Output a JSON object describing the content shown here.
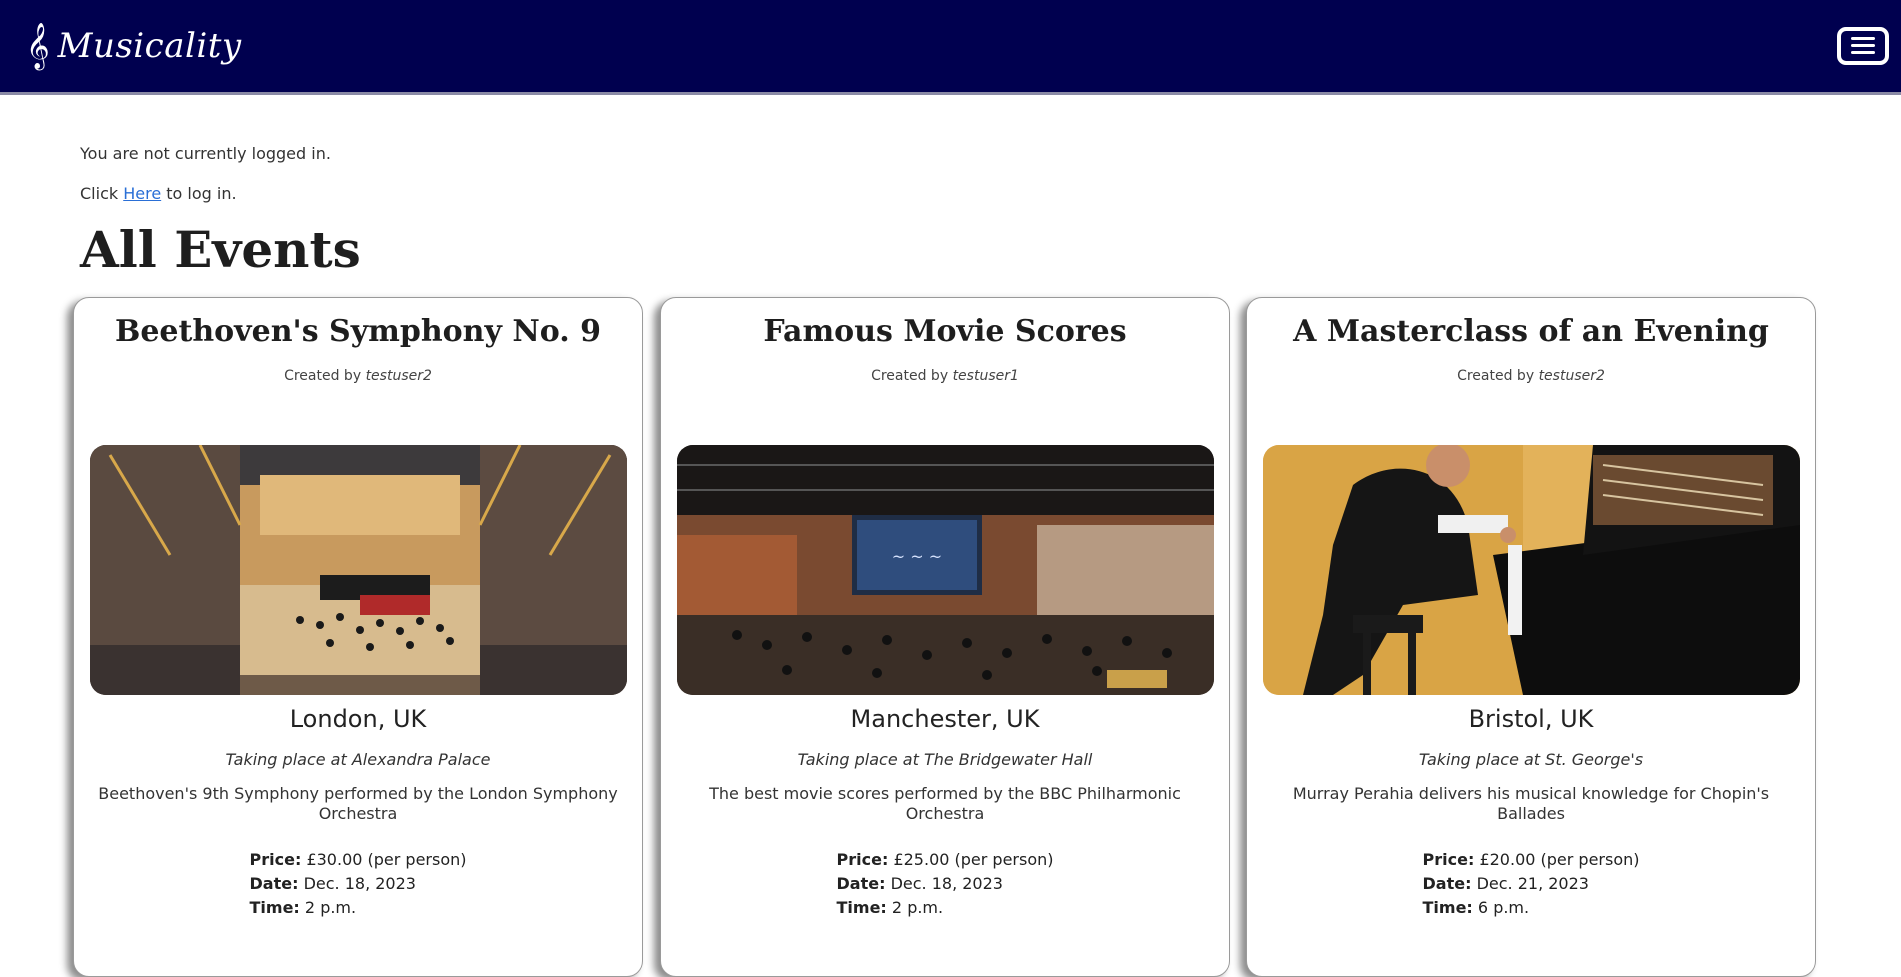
{
  "navbar": {
    "brand_icon": "treble-clef-icon",
    "brand_name": "Musicality",
    "menu_icon": "hamburger-menu-icon",
    "background": "#00004f"
  },
  "auth": {
    "status_text": "You are not currently logged in.",
    "click_text": "Click",
    "link_text": "Here",
    "after_link_text": "to log in."
  },
  "page_title": "All Events",
  "events": [
    {
      "title": "Beethoven's Symphony No. 9",
      "created_by_label": "Created by",
      "creator": "testuser2",
      "image": "concert-hall-orchestra-photo",
      "city": "London, UK",
      "venue": "Taking place at Alexandra Palace",
      "description": "Beethoven's 9th Symphony performed by the London Symphony Orchestra",
      "price_label": "Price:",
      "price": "£30.00 (per person)",
      "date_label": "Date:",
      "date": "Dec. 18, 2023",
      "time_label": "Time:",
      "time": "2 p.m."
    },
    {
      "title": "Famous Movie Scores",
      "created_by_label": "Created by",
      "creator": "testuser1",
      "image": "bbc-philharmonic-studio-photo",
      "city": "Manchester, UK",
      "venue": "Taking place at The Bridgewater Hall",
      "description": "The best movie scores performed by the BBC Philharmonic Orchestra",
      "price_label": "Price:",
      "price": "£25.00 (per person)",
      "date_label": "Date:",
      "date": "Dec. 18, 2023",
      "time_label": "Time:",
      "time": "2 p.m."
    },
    {
      "title": "A Masterclass of an Evening",
      "created_by_label": "Created by",
      "creator": "testuser2",
      "image": "pianist-grand-piano-photo",
      "city": "Bristol, UK",
      "venue": "Taking place at St. George's",
      "description": "Murray Perahia delivers his musical knowledge for Chopin's Ballades",
      "price_label": "Price:",
      "price": "£20.00 (per person)",
      "date_label": "Date:",
      "date": "Dec. 21, 2023",
      "time_label": "Time:",
      "time": "6 p.m."
    }
  ]
}
